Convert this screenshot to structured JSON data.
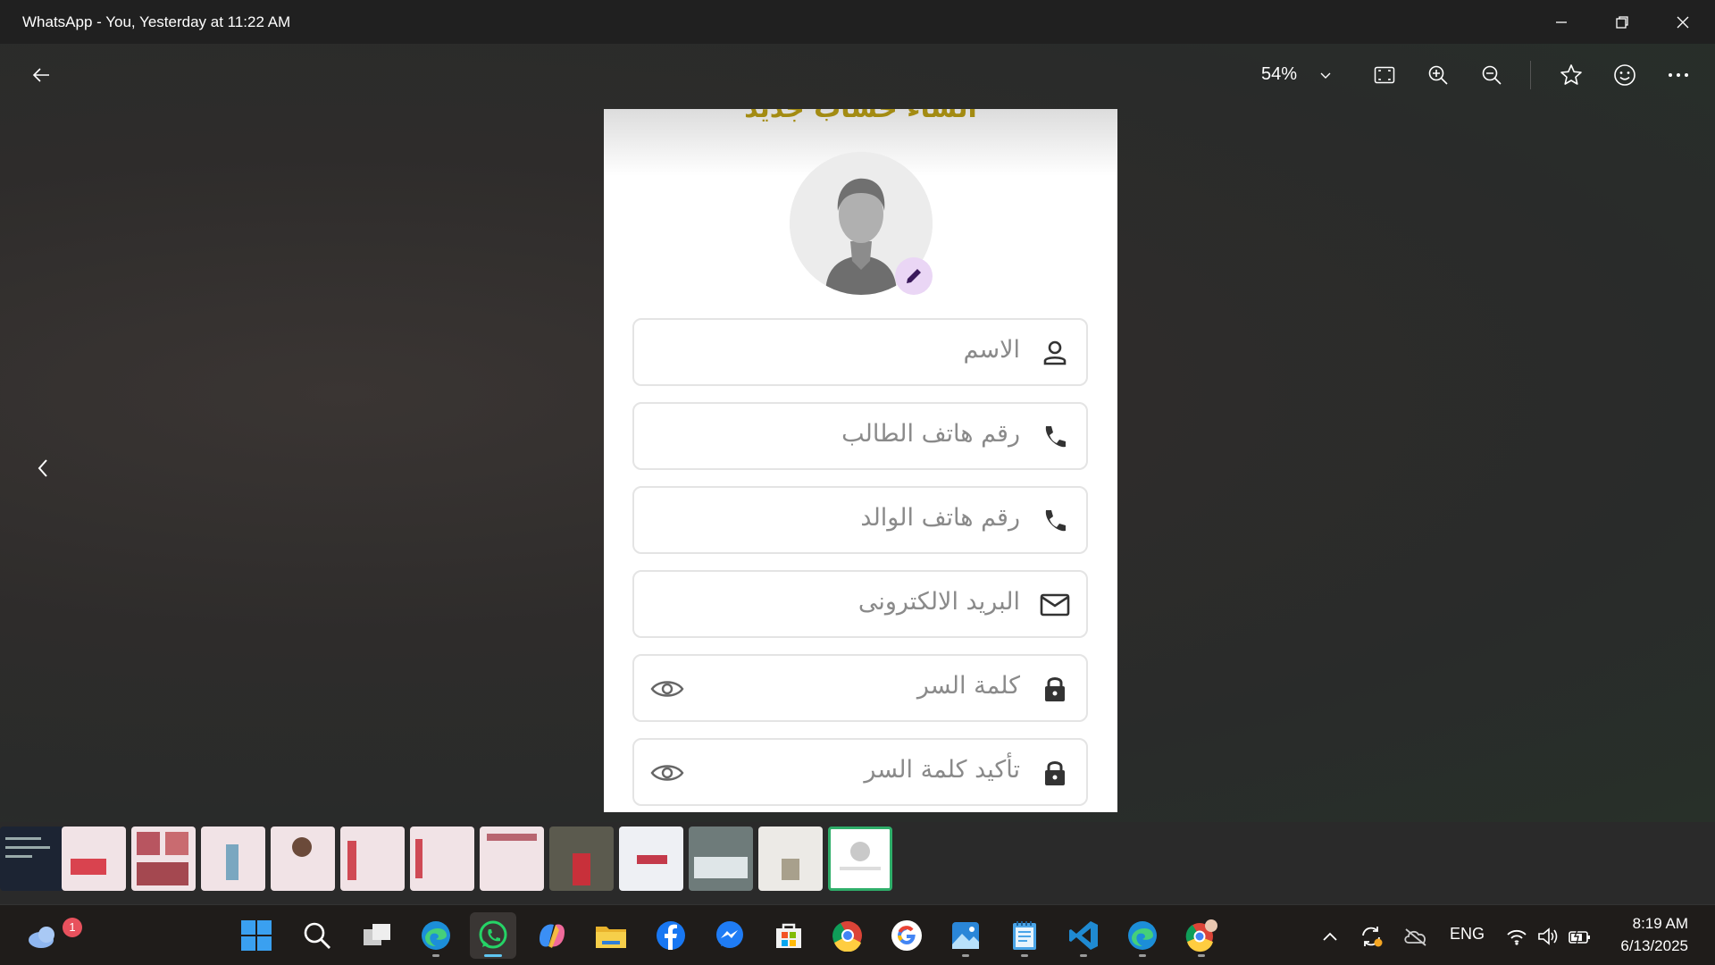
{
  "window": {
    "title": "WhatsApp - You, Yesterday at 11:22 AM"
  },
  "toolbar": {
    "zoom_level": "54%"
  },
  "photo": {
    "heading": "انشاء حساب جديد",
    "fields": [
      {
        "placeholder": "الاسم",
        "icon": "person-icon"
      },
      {
        "placeholder": "رقم هاتف الطالب",
        "icon": "phone-icon"
      },
      {
        "placeholder": "رقم هاتف الوالد",
        "icon": "phone-icon"
      },
      {
        "placeholder": "البريد الالكترونى",
        "icon": "mail-icon"
      },
      {
        "placeholder": "كلمة السر",
        "icon": "lock-icon"
      },
      {
        "placeholder": "تأكيد كلمة السر",
        "icon": "lock-icon"
      }
    ]
  },
  "filmstrip": {
    "count": 13,
    "active_index": 12
  },
  "taskbar": {
    "weather_badge": "1",
    "apps": [
      "windows-start-icon",
      "search-icon",
      "task-view-icon",
      "edge-icon",
      "whatsapp-icon",
      "copilot-icon",
      "file-explorer-icon",
      "facebook-icon",
      "messenger-icon",
      "store-icon",
      "chrome-icon",
      "google-icon",
      "photos-icon",
      "notepad-icon",
      "vscode-icon",
      "edge-icon",
      "chrome-profile-icon"
    ],
    "active_app": "whatsapp-icon",
    "language": "ENG",
    "time": "8:19 AM",
    "date": "6/13/2025"
  },
  "colors": {
    "accent": "#2fae6a",
    "heading_gold": "#a38b12",
    "edit_badge": "#ead6f5"
  }
}
